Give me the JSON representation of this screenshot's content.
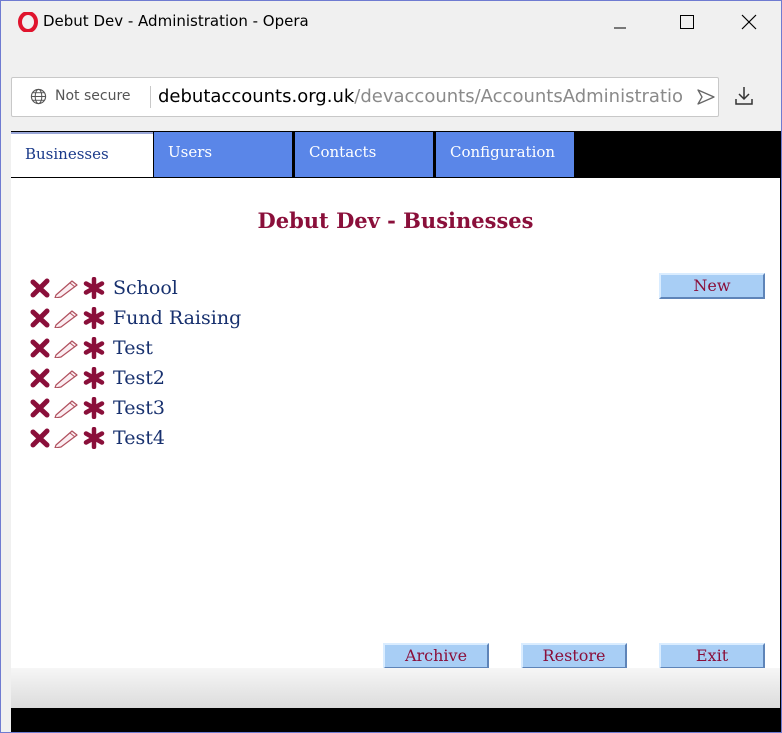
{
  "window": {
    "title": "Debut Dev - Administration - Opera",
    "minimize_glyph": "_",
    "maximize_icon": "square-icon",
    "close_glyph": "✕"
  },
  "address_bar": {
    "security_label": "Not secure",
    "url_host": "debutaccounts.org.uk",
    "url_path": "/devaccounts/AccountsAdministratio"
  },
  "tabs": [
    {
      "label": "Businesses",
      "active": true
    },
    {
      "label": "Users",
      "active": false
    },
    {
      "label": "Contacts",
      "active": false
    },
    {
      "label": "Configuration",
      "active": false
    }
  ],
  "main": {
    "heading": "Debut Dev - Businesses",
    "new_button": "New",
    "archive_button": "Archive",
    "restore_button": "Restore",
    "exit_button": "Exit"
  },
  "businesses": [
    {
      "name": "School"
    },
    {
      "name": "Fund Raising"
    },
    {
      "name": "Test"
    },
    {
      "name": "Test2"
    },
    {
      "name": "Test3"
    },
    {
      "name": "Test4"
    }
  ],
  "colors": {
    "heading": "#8a0f3a",
    "tab_inactive": "#5a86e8",
    "button_bg": "#a8cef5",
    "link": "#17306e"
  }
}
